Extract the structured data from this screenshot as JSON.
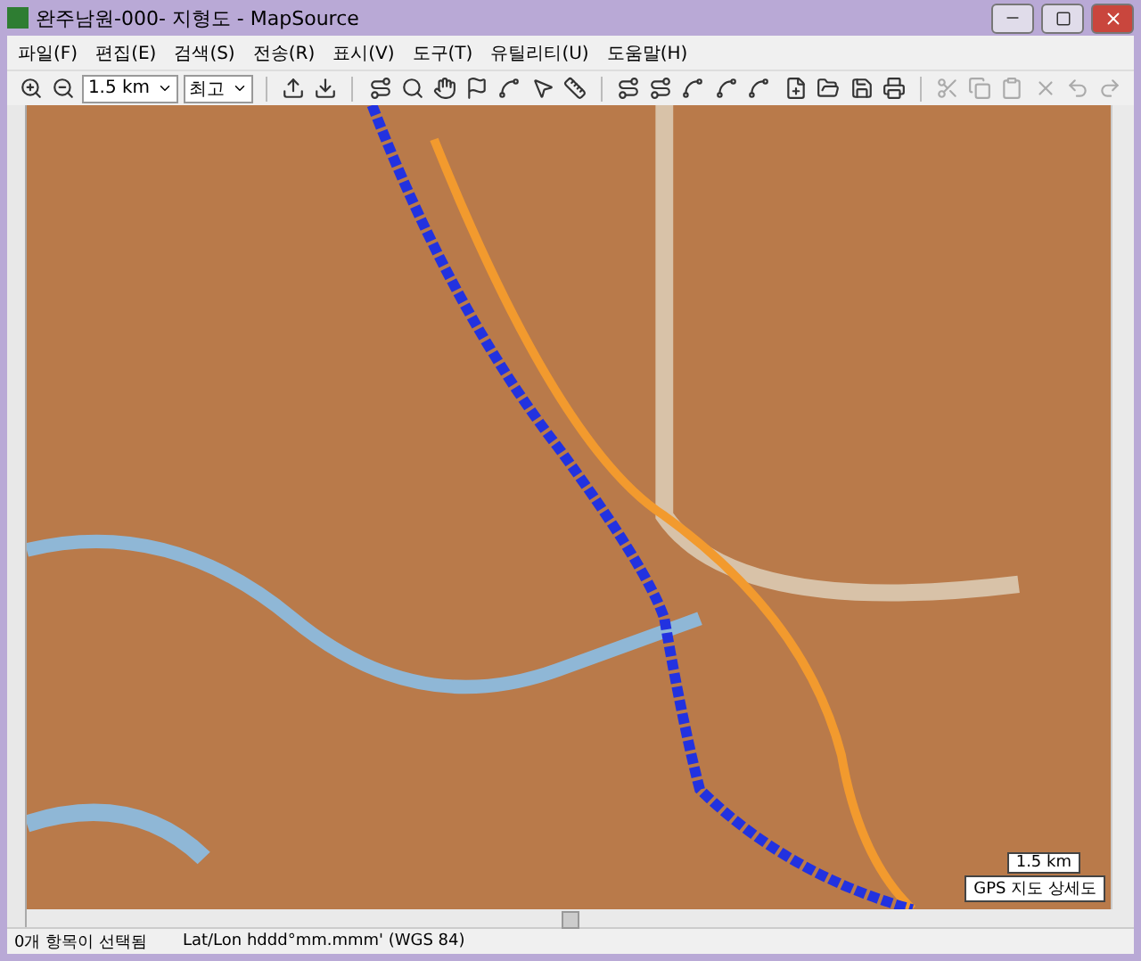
{
  "window": {
    "title": "완주남원-000- 지형도 - MapSource"
  },
  "menu": [
    "파일(F)",
    "편집(E)",
    "검색(S)",
    "전송(R)",
    "표시(V)",
    "도구(T)",
    "유틸리티(U)",
    "도움말(H)"
  ],
  "toolbar": {
    "zoom": "1.5 km",
    "detail": "최고"
  },
  "map": {
    "scale": "1.5 km",
    "legend": "GPS 지도 상세도"
  },
  "status_bar": {
    "selection": "0개 항목이 선택됨",
    "format": "Lat/Lon hddd°mm.mmm' (WGS 84)"
  }
}
